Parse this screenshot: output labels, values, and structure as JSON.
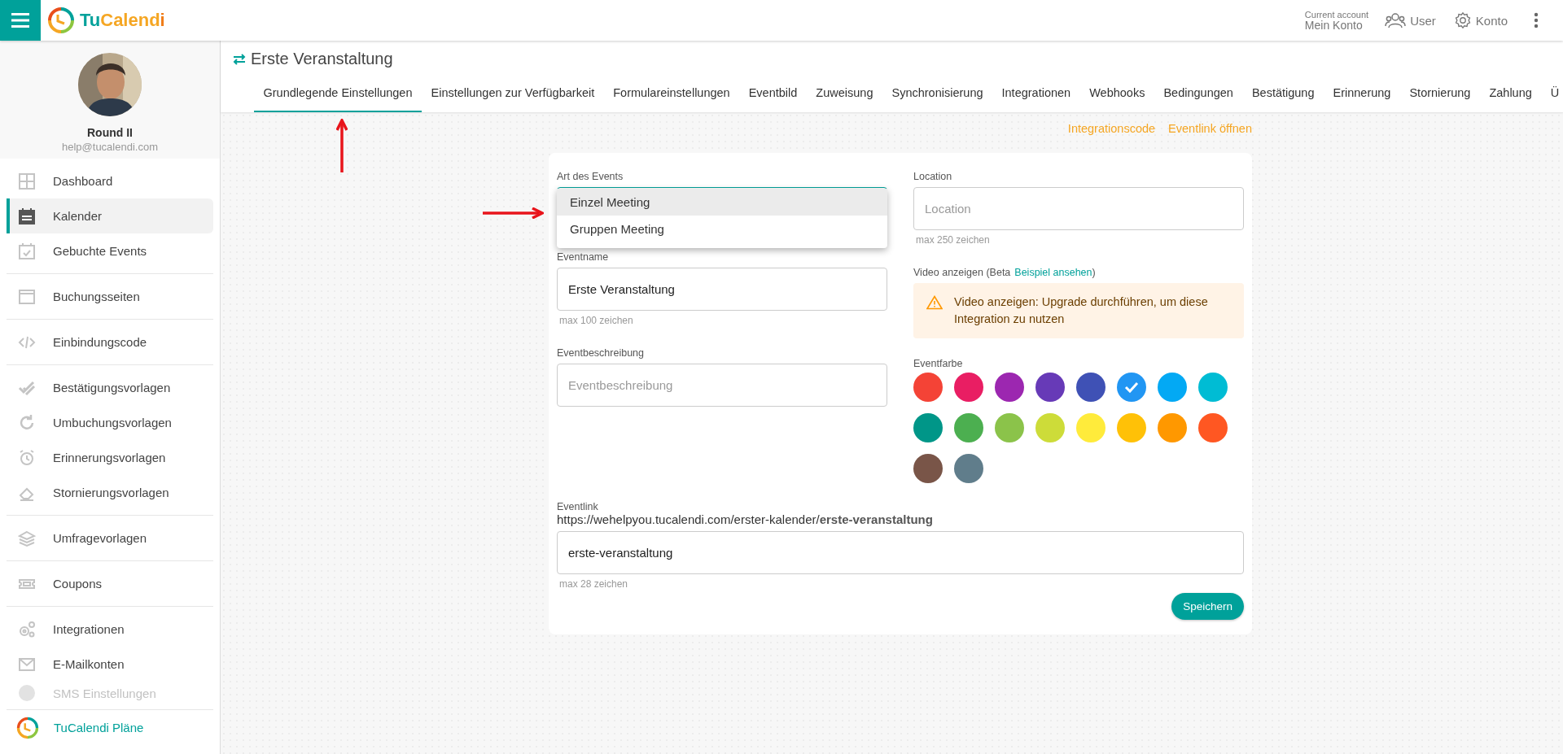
{
  "topbar": {
    "logo": [
      {
        "text": "Tu",
        "color": "#00a19a"
      },
      {
        "text": "Calend",
        "color": "#f5a623"
      },
      {
        "text": "i",
        "color": "#f07d1a"
      }
    ],
    "account_caption": "Current account",
    "account_name": "Mein Konto",
    "user_label": "User",
    "konto_label": "Konto"
  },
  "sidebar": {
    "profile": {
      "name": "Round II",
      "email": "help@tucalendi.com"
    },
    "sections": [
      {
        "items": [
          {
            "label": "Dashboard",
            "selected": false,
            "disabled": false
          },
          {
            "label": "Kalender",
            "selected": true,
            "disabled": false
          },
          {
            "label": "Gebuchte Events",
            "selected": false,
            "disabled": false
          }
        ]
      },
      {
        "items": [
          {
            "label": "Buchungsseiten",
            "selected": false,
            "disabled": false
          }
        ]
      },
      {
        "items": [
          {
            "label": "Einbindungscode",
            "selected": false,
            "disabled": false
          }
        ]
      },
      {
        "items": [
          {
            "label": "Bestätigungsvorlagen",
            "selected": false,
            "disabled": false
          },
          {
            "label": "Umbuchungsvorlagen",
            "selected": false,
            "disabled": false
          },
          {
            "label": "Erinnerungsvorlagen",
            "selected": false,
            "disabled": false
          },
          {
            "label": "Stornierungsvorlagen",
            "selected": false,
            "disabled": false
          }
        ]
      },
      {
        "items": [
          {
            "label": "Umfragevorlagen",
            "selected": false,
            "disabled": false
          }
        ]
      },
      {
        "items": [
          {
            "label": "Coupons",
            "selected": false,
            "disabled": false
          }
        ]
      },
      {
        "items": [
          {
            "label": "Integrationen",
            "selected": false,
            "disabled": false
          },
          {
            "label": "E-Mailkonten",
            "selected": false,
            "disabled": false
          },
          {
            "label": "SMS Einstellungen",
            "selected": false,
            "disabled": true
          }
        ]
      }
    ],
    "plans_link": "TuCalendi Pläne"
  },
  "page": {
    "title": "Erste Veranstaltung",
    "tabs": [
      {
        "label": "Grundlegende Einstellungen",
        "selected": true
      },
      {
        "label": "Einstellungen zur Verfügbarkeit",
        "selected": false
      },
      {
        "label": "Formulareinstellungen",
        "selected": false
      },
      {
        "label": "Eventbild",
        "selected": false
      },
      {
        "label": "Zuweisung",
        "selected": false
      },
      {
        "label": "Synchronisierung",
        "selected": false
      },
      {
        "label": "Integrationen",
        "selected": false
      },
      {
        "label": "Webhooks",
        "selected": false
      },
      {
        "label": "Bedingungen",
        "selected": false
      },
      {
        "label": "Bestätigung",
        "selected": false
      },
      {
        "label": "Erinnerung",
        "selected": false
      },
      {
        "label": "Stornierung",
        "selected": false
      },
      {
        "label": "Zahlung",
        "selected": false
      },
      {
        "label": "Ü",
        "selected": false
      }
    ],
    "links": [
      "Integrationscode",
      "Eventlink öffnen"
    ]
  },
  "form": {
    "event_type": {
      "label": "Art des Events",
      "expanded": true,
      "options": [
        {
          "label": "Einzel Meeting",
          "selected": true
        },
        {
          "label": "Gruppen Meeting",
          "selected": false
        }
      ]
    },
    "event_name": {
      "label": "Eventname",
      "value": "Erste Veranstaltung",
      "hint": "max 100 zeichen"
    },
    "description": {
      "label": "Eventbeschreibung",
      "placeholder": "Eventbeschreibung"
    },
    "location": {
      "label": "Location",
      "placeholder": "Location",
      "hint": "max 250 zeichen"
    },
    "video": {
      "label": "Video anzeigen  (Beta",
      "link": "Beispiel ansehen",
      "suffix": ")",
      "alert": "Video anzeigen: Upgrade durchführen, um diese Integration zu nutzen"
    },
    "color": {
      "label": "Eventfarbe",
      "swatches": [
        {
          "color": "#f44336",
          "selected": false
        },
        {
          "color": "#e91e63",
          "selected": false
        },
        {
          "color": "#9c27b0",
          "selected": false
        },
        {
          "color": "#673ab7",
          "selected": false
        },
        {
          "color": "#3f51b5",
          "selected": false
        },
        {
          "color": "#2196f3",
          "selected": true
        },
        {
          "color": "#03a9f4",
          "selected": false
        },
        {
          "color": "#00bcd4",
          "selected": false
        },
        {
          "color": "#009688",
          "selected": false
        },
        {
          "color": "#4caf50",
          "selected": false
        },
        {
          "color": "#8bc34a",
          "selected": false
        },
        {
          "color": "#cddc39",
          "selected": false
        },
        {
          "color": "#ffeb3b",
          "selected": false
        },
        {
          "color": "#ffc107",
          "selected": false
        },
        {
          "color": "#ff9800",
          "selected": false
        },
        {
          "color": "#ff5722",
          "selected": false
        },
        {
          "color": "#795548",
          "selected": false
        },
        {
          "color": "#607d8b",
          "selected": false
        }
      ]
    },
    "eventlink": {
      "label": "Eventlink",
      "url": "https://wehelpyou.tucalendi.com/erster-kalender/**erste-veranstaltung**",
      "value": "erste-veranstaltung",
      "hint": "max 28 zeichen"
    },
    "save": "Speichern"
  }
}
